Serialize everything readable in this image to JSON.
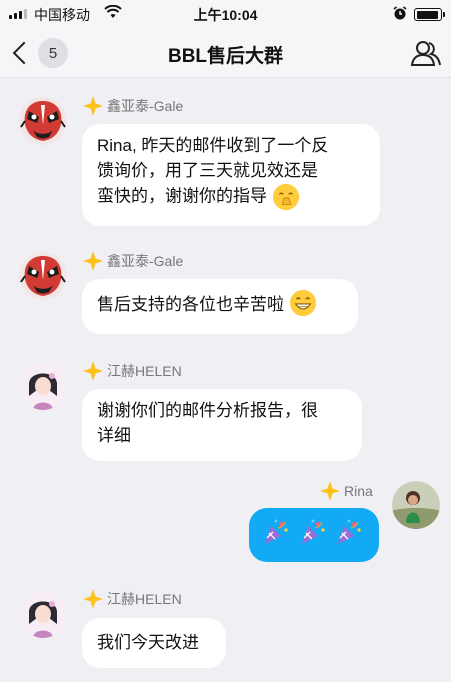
{
  "status_bar": {
    "carrier": "中国移动",
    "time": "上午10:04",
    "battery_level": 0.95,
    "signal_bars": 4,
    "wifi_icon": "wifi-icon",
    "alarm_icon": "alarm-icon"
  },
  "nav": {
    "back_icon": "chevron-left-icon",
    "unread_count": "5",
    "title": "BBL售后大群",
    "group_icon": "group-members-icon"
  },
  "colors": {
    "background": "#efeff4",
    "bubble_other": "#ffffff",
    "bubble_mine": "#12a9f5",
    "sender_name": "#777777",
    "star_badge": "#ffc21a"
  },
  "messages": [
    {
      "sender": "鑫亚泰-Gale",
      "avatar": "opera-mask-avatar",
      "mine": false,
      "lines": [
        "Rina, 昨天的邮件收到了一个反",
        "馈询价，用了三天就见效还是",
        "蛮快的，谢谢你的指导"
      ],
      "trailing_emoji": "thanks-emoji"
    },
    {
      "sender": "鑫亚泰-Gale",
      "avatar": "opera-mask-avatar",
      "mine": false,
      "lines": [
        "售后支持的各位也辛苦啦"
      ],
      "trailing_emoji": "grin-emoji"
    },
    {
      "sender": "江赫HELEN",
      "avatar": "girl-portrait-avatar",
      "mine": false,
      "lines": [
        "谢谢你们的邮件分析报告，很",
        "详细"
      ]
    },
    {
      "sender": "Rina",
      "avatar": "child-photo-avatar",
      "mine": true,
      "emoji_row": [
        "party-popper-emoji",
        "party-popper-emoji",
        "party-popper-emoji"
      ]
    },
    {
      "sender": "江赫HELEN",
      "avatar": "girl-portrait-avatar",
      "mine": false,
      "lines": [
        "我们今天改进"
      ]
    }
  ]
}
